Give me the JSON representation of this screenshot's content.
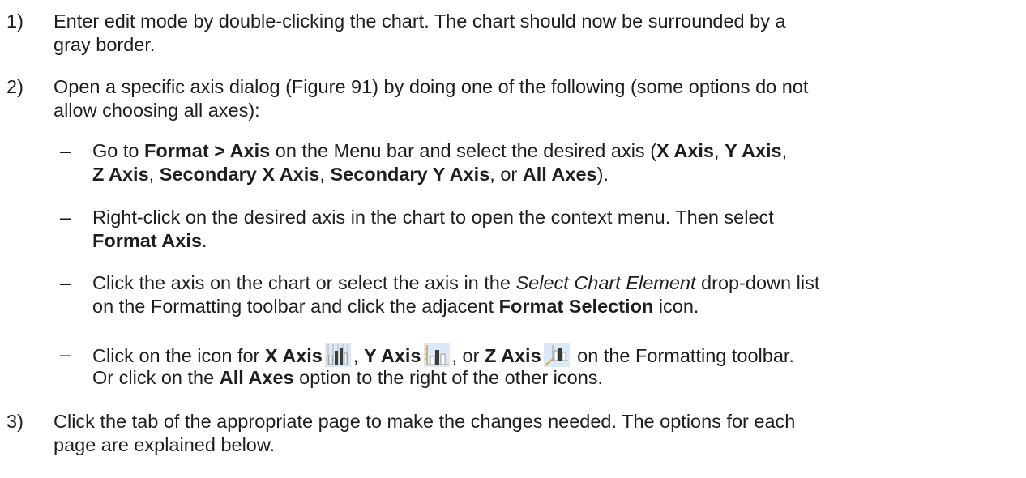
{
  "steps": [
    {
      "number": "1)",
      "lines": [
        "Enter edit mode by double-clicking the chart. The chart should now be surrounded by a",
        "gray border."
      ]
    },
    {
      "number": "2)",
      "lines": [
        "Open a specific axis dialog (Figure 91) by doing one of the following (some options do not",
        "allow choosing all axes):"
      ],
      "substeps": [
        {
          "dash": "–",
          "l1": {
            "t1": "Go to ",
            "b1": "Format > Axis",
            "t2": " on the Menu bar and select the desired axis (",
            "b2": "X Axis",
            "t3": ", ",
            "b3": "Y Axis",
            "t4": ","
          },
          "l2": {
            "b1": "Z Axis",
            "t1": ", ",
            "b2": "Secondary X Axis",
            "t2": ", ",
            "b3": "Secondary Y Axis",
            "t3": ", or ",
            "b4": "All Axes",
            "t4": ")."
          }
        },
        {
          "dash": "–",
          "l1": "Right-click on the desired axis in the chart to open the context menu. Then select",
          "l2": {
            "b1": "Format Axis",
            "t1": "."
          }
        },
        {
          "dash": "–",
          "l1": {
            "t1": "Click the axis on the chart or select the axis in the ",
            "i1": "Select Chart Element",
            "t2": " drop-down list"
          },
          "l2": {
            "t1": "on the Formatting toolbar and click the adjacent ",
            "b1": "Format Selection",
            "t2": " icon."
          }
        },
        {
          "dash": "–",
          "l1": {
            "t1": "Click on the icon for ",
            "b1": "X Axis",
            "t2": ", ",
            "b2": "Y Axis",
            "t3": ", or ",
            "b3": "Z Axis",
            "t4": " on the Formatting toolbar."
          },
          "l2": {
            "t1": "Or click on the ",
            "b1": "All Axes",
            "t2": " option to the right of the other icons."
          },
          "icons": [
            "x-axis-icon",
            "y-axis-icon",
            "z-axis-icon"
          ]
        }
      ]
    },
    {
      "number": "3)",
      "lines": [
        "Click the tab of the appropriate page to make the changes needed. The options for each",
        "page are explained below."
      ]
    }
  ]
}
